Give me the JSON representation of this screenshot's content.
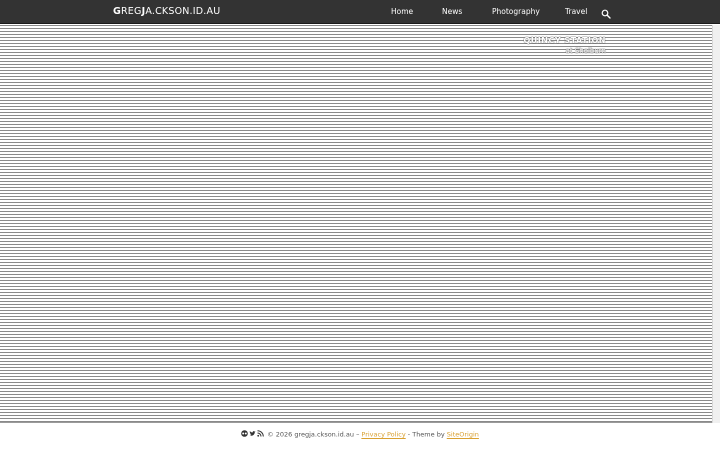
{
  "header": {
    "logo_first_letter": "G",
    "logo_part1": "REG",
    "logo_bold_letter": "J",
    "logo_part2": "A.CKSON.ID.AU",
    "nav": [
      {
        "label": "Home"
      },
      {
        "label": "News"
      },
      {
        "label": "Photography"
      },
      {
        "label": "Travel"
      }
    ],
    "search_icon": "search-icon"
  },
  "hero": {
    "title": "QUINCY STATION",
    "subtitle": "at Shelburn"
  },
  "footer": {
    "icons": [
      "flickr-icon",
      "twitter-icon",
      "rss-icon"
    ],
    "copyright": "© 2026 gregja.ckson.id.au",
    "sep1": "–",
    "privacy": "Privacy Policy",
    "sep2": "-",
    "theme_by": "Theme by",
    "theme_link": "SiteOrigin"
  },
  "colors": {
    "topbar": "#333333",
    "footer_link": "#d9a030"
  }
}
